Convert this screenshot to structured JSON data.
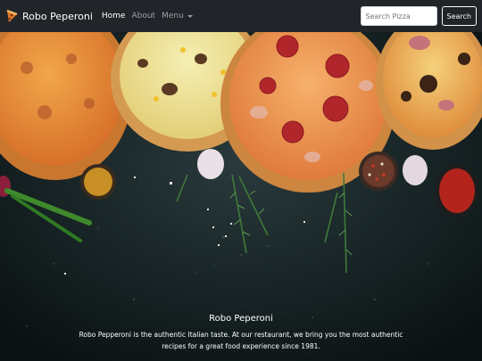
{
  "navbar": {
    "brand_name": "Robo Peperoni",
    "links": [
      {
        "label": "Home"
      },
      {
        "label": "About"
      }
    ],
    "menu_label": "Menu",
    "search_placeholder": "Search Pizza",
    "search_button_label": "Search"
  },
  "hero": {
    "title": "Robo Peperoni",
    "text": "Robo Pepperoni is the authentic Italian taste. At our restaurant, we bring you the most authentic recipes for a great food experience since 1981."
  }
}
